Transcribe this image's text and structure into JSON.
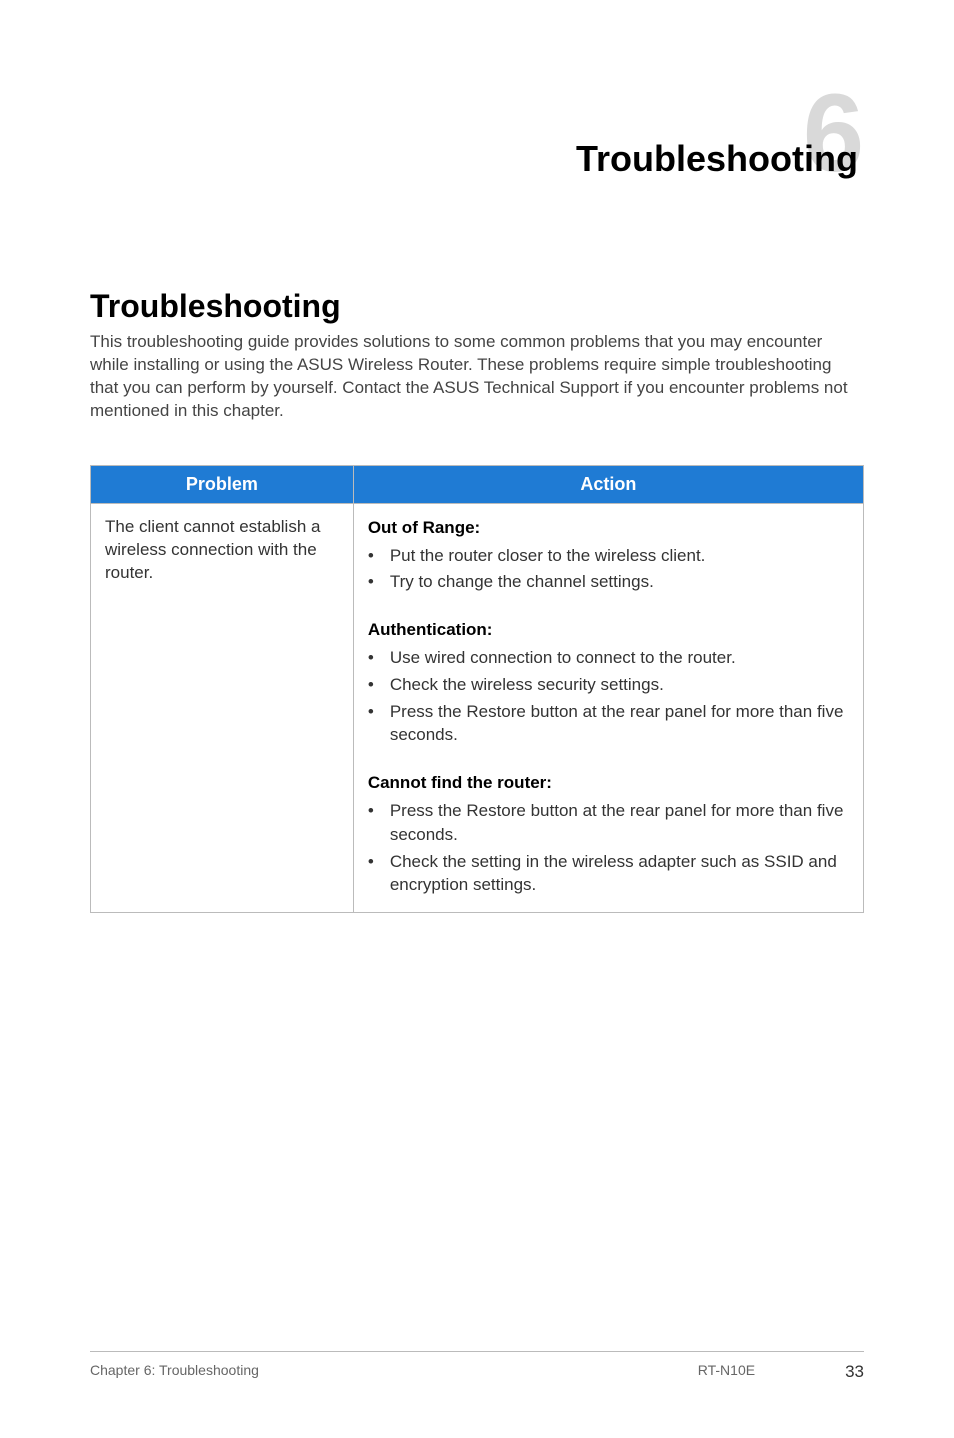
{
  "chapter": {
    "number": "6",
    "title": "Troubleshooting"
  },
  "section": {
    "title": "Troubleshooting",
    "intro": "This troubleshooting guide provides solutions to some common problems that you may encounter while installing or using the ASUS Wireless Router. These problems require simple troubleshooting that you can perform by yourself. Contact the ASUS Technical Support if you encounter problems not mentioned in this chapter."
  },
  "table": {
    "headers": {
      "problem": "Problem",
      "action": "Action"
    },
    "row": {
      "problem": "The client cannot establish a wireless connection with the router.",
      "groups": [
        {
          "heading": "Out of Range:",
          "bullets": [
            "Put the router closer to the wireless client.",
            "Try to change the channel settings."
          ]
        },
        {
          "heading": "Authentication:",
          "bullets": [
            "Use wired connection to connect to the router.",
            "Check the wireless security settings.",
            "Press the Restore button at the rear panel for more than five seconds."
          ]
        },
        {
          "heading": "Cannot find the router:",
          "bullets": [
            "Press the Restore button at the rear panel for more than five seconds.",
            "Check the setting in the wireless adapter such as SSID and encryption settings."
          ]
        }
      ]
    }
  },
  "footer": {
    "left": "Chapter 6: Troubleshooting",
    "model": "RT-N10E",
    "page": "33"
  }
}
